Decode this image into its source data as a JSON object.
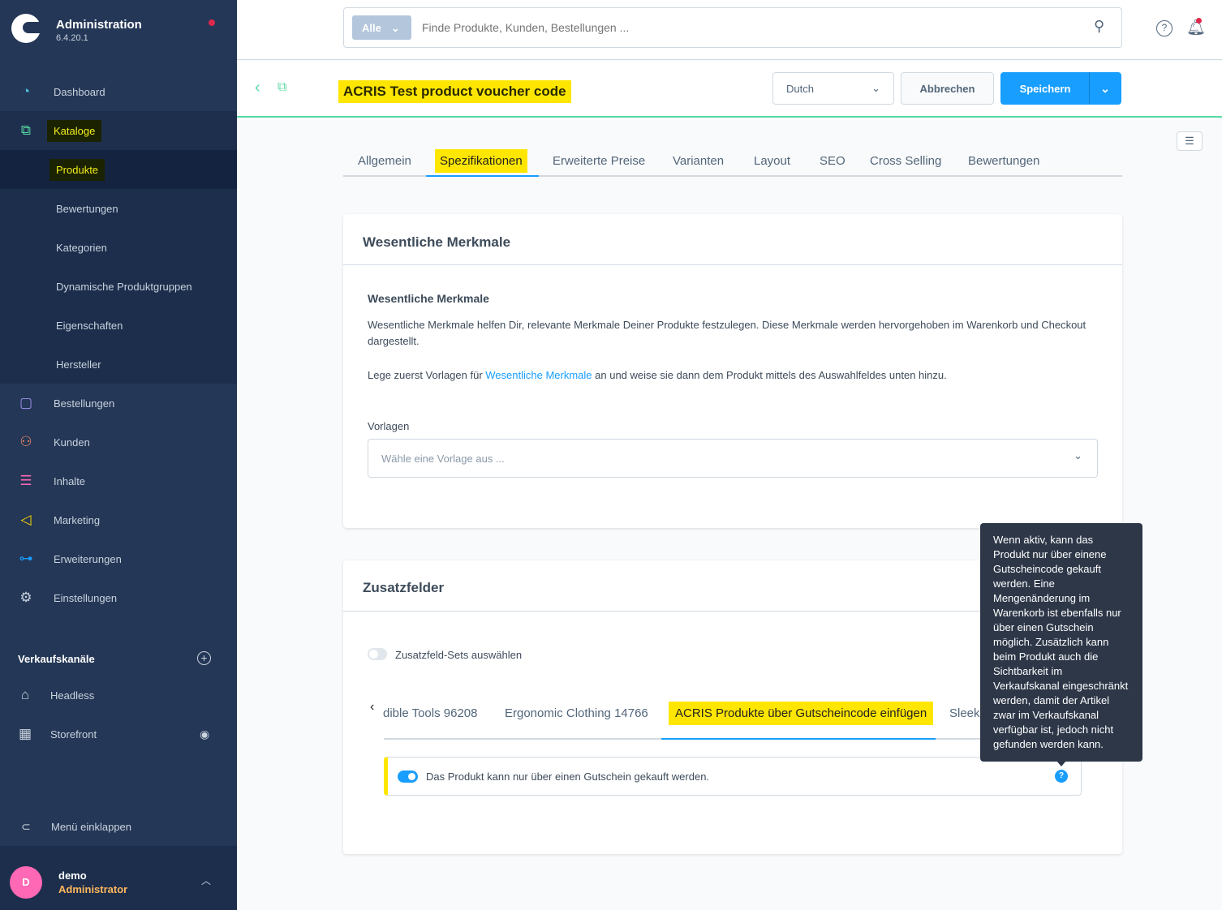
{
  "sidebar": {
    "app_title": "Administration",
    "version": "6.4.20.1",
    "items": [
      {
        "label": "Dashboard",
        "icon": "gauge-icon"
      },
      {
        "label": "Kataloge",
        "icon": "catalog-icon"
      },
      {
        "label": "Produkte"
      },
      {
        "label": "Bewertungen"
      },
      {
        "label": "Kategorien"
      },
      {
        "label": "Dynamische Produktgruppen"
      },
      {
        "label": "Eigenschaften"
      },
      {
        "label": "Hersteller"
      },
      {
        "label": "Bestellungen",
        "icon": "bag-icon"
      },
      {
        "label": "Kunden",
        "icon": "users-icon"
      },
      {
        "label": "Inhalte",
        "icon": "content-icon"
      },
      {
        "label": "Marketing",
        "icon": "megaphone-icon"
      },
      {
        "label": "Erweiterungen",
        "icon": "plug-icon"
      },
      {
        "label": "Einstellungen",
        "icon": "gear-icon"
      }
    ],
    "sales_channels_title": "Verkaufskanäle",
    "sales_channels": [
      {
        "label": "Headless"
      },
      {
        "label": "Storefront"
      }
    ],
    "collapse": "Menü einklappen",
    "user": {
      "initial": "D",
      "name": "demo",
      "role": "Administrator"
    }
  },
  "search": {
    "scope": "Alle",
    "placeholder": "Finde Produkte, Kunden, Bestellungen ..."
  },
  "header": {
    "title": "ACRIS Test product voucher code",
    "language": "Dutch",
    "cancel": "Abbrechen",
    "save": "Speichern"
  },
  "tabs": [
    "Allgemein",
    "Spezifikationen",
    "Erweiterte Preise",
    "Varianten",
    "Layout",
    "SEO",
    "Cross Selling",
    "Bewertungen"
  ],
  "essentials": {
    "card_title": "Wesentliche Merkmale",
    "heading": "Wesentliche Merkmale",
    "desc": "Wesentliche Merkmale helfen Dir, relevante Merkmale Deiner Produkte festzulegen. Diese Merkmale werden hervorgehoben im Warenkorb und Checkout dargestellt.",
    "hint_pre": "Lege zuerst Vorlagen für ",
    "hint_link": "Wesentliche Merkmale",
    "hint_post": " an und weise sie dann dem Produkt mittels des Auswahlfeldes unten hinzu.",
    "field_label": "Vorlagen",
    "field_placeholder": "Wähle eine Vorlage aus ..."
  },
  "custom_fields": {
    "card_title": "Zusatzfelder",
    "toggle_label": "Zusatzfeld-Sets auswählen",
    "toggle_on": false,
    "tabs": [
      "dible Tools 96208",
      "Ergonomic Clothing 14766",
      "ACRIS Produkte über Gutscheincode einfügen",
      "Sleek"
    ],
    "switch_label": "Das Produkt kann nur über einen Gutschein gekauft werden.",
    "switch_on": true,
    "tooltip": "Wenn aktiv, kann das Produkt nur über einene Gutscheincode gekauft werden. Eine Mengenänderung im Warenkorb ist ebenfalls nur über einen Gutschein möglich. Zusätzlich kann beim Produkt auch die Sichtbarkeit im Verkaufskanal eingeschränkt werden, damit der Artikel zwar im Verkaufskanal verfügbar ist, jedoch nicht gefunden werden kann."
  },
  "colors": {
    "accent": "#189eff",
    "highlight": "#ffe600",
    "sidebar": "#243756",
    "success": "#57d9a3"
  }
}
